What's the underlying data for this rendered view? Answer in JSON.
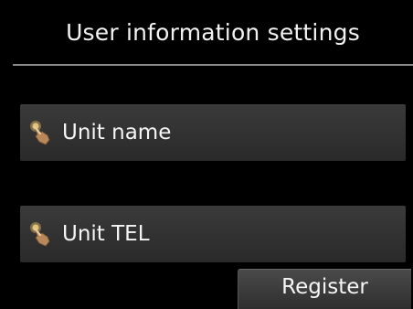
{
  "header": {
    "title": "User information settings"
  },
  "menu": {
    "items": [
      {
        "label": "Unit name",
        "icon": "hand-pointer-icon"
      },
      {
        "label": "Unit TEL",
        "icon": "hand-pointer-icon"
      }
    ]
  },
  "actions": {
    "register_label": "Register"
  },
  "colors": {
    "background": "#000000",
    "item_background": "#333333",
    "text": "#ffffff",
    "icon_hand": "#c8a060"
  }
}
